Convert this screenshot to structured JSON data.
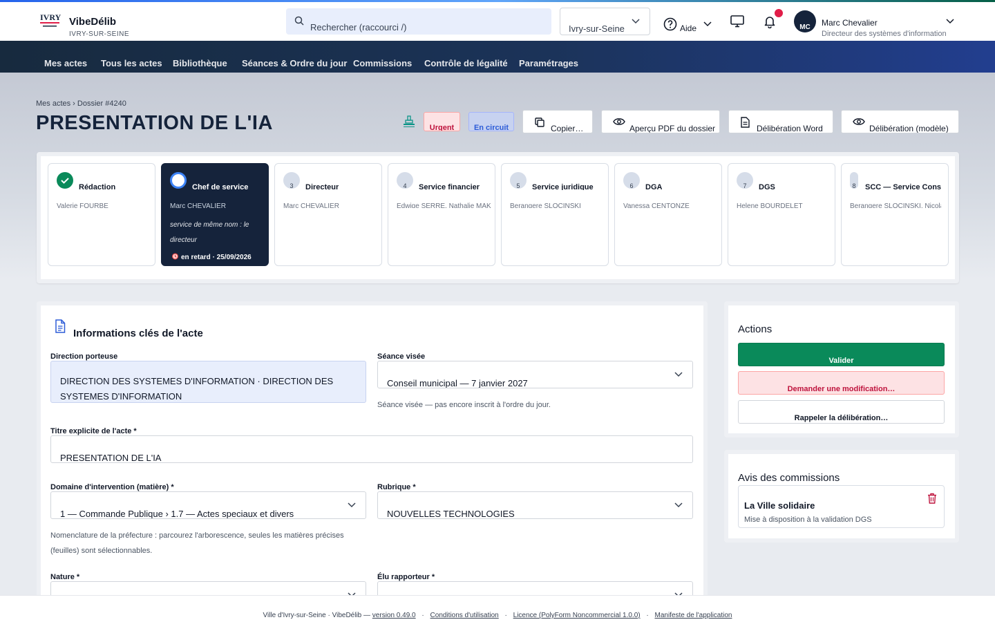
{
  "app": {
    "name": "VibeDélib",
    "city_caption": "IVRY-SUR-SEINE",
    "logo_text": "IVRY"
  },
  "header": {
    "search_placeholder": "Rechercher (raccourci /)",
    "city": "Ivry-sur-Seine",
    "help_label": "Aide",
    "user": {
      "initials": "MC",
      "name": "Marc Chevalier",
      "role": "Directeur des systèmes d'information"
    }
  },
  "nav": [
    "Mes actes",
    "Tous les actes",
    "Bibliothèque",
    "Séances & Ordre du jour",
    "Commissions",
    "Contrôle de légalité",
    "Paramétrages"
  ],
  "page": {
    "breadcrumb": "Mes actes › Dossier #4240",
    "title": "PRESENTATION DE L'IA",
    "badges": {
      "urgent": "Urgent",
      "circuit": "En circuit"
    },
    "buttons": {
      "copy": "Copier…",
      "pdf": "Aperçu PDF du dossier",
      "word": "Délibération Word",
      "model": "Délibération (modèle)"
    }
  },
  "steps": [
    {
      "num": "",
      "title": "Rédaction",
      "person": "Valerie FOURBE",
      "state": "done"
    },
    {
      "num": "",
      "title": "Chef de service",
      "person": "Marc CHEVALIER",
      "note": "service de même nom : le directeur",
      "late": "en retard · 25/09/2026",
      "state": "current"
    },
    {
      "num": "3",
      "title": "Directeur",
      "person": "Marc CHEVALIER",
      "state": "todo"
    },
    {
      "num": "4",
      "title": "Service financier",
      "person": "Edwige SERRE, Nathalie MAK",
      "state": "todo"
    },
    {
      "num": "5",
      "title": "Service juridique",
      "person": "Berangere SLOCINSKI",
      "state": "todo"
    },
    {
      "num": "6",
      "title": "DGA",
      "person": "Vanessa CENTONZE",
      "state": "todo"
    },
    {
      "num": "7",
      "title": "DGS",
      "person": "Helene BOURDELET",
      "state": "todo"
    },
    {
      "num": "8",
      "title": "SCC — Service Conseil",
      "person": "Berangere SLOCINSKI, Nicolas",
      "state": "todo"
    }
  ],
  "info": {
    "title": "Informations clés de l'acte",
    "direction": {
      "label": "Direction porteuse",
      "value": "DIRECTION DES SYSTEMES D'INFORMATION · DIRECTION DES SYSTEMES D'INFORMATION"
    },
    "seance": {
      "label": "Séance visée",
      "value": "Conseil municipal — 7 janvier 2027",
      "help": "Séance visée — pas encore inscrit à l'ordre du jour."
    },
    "titre": {
      "label": "Titre explicite de l'acte *",
      "value": "PRESENTATION DE L'IA"
    },
    "domaine": {
      "label": "Domaine d'intervention (matière) *",
      "value": "1 — Commande Publique › 1.7 — Actes speciaux et divers",
      "help": "Nomenclature de la préfecture : parcourez l'arborescence, seules les matières précises (feuilles) sont sélectionnables."
    },
    "rubrique": {
      "label": "Rubrique *",
      "value": "NOUVELLES TECHNOLOGIES"
    },
    "nature": {
      "label": "Nature *",
      "value": ""
    },
    "elu": {
      "label": "Élu rapporteur *",
      "value": ""
    }
  },
  "actions": {
    "title": "Actions",
    "valider": "Valider",
    "modification": "Demander une modification…",
    "rappeler": "Rappeler la délibération…"
  },
  "avis": {
    "title": "Avis des commissions",
    "items": [
      {
        "name": "La Ville solidaire",
        "status": "Mise à disposition à la validation DGS"
      }
    ]
  },
  "footer": {
    "prefix": "Ville d'Ivry-sur-Seine · VibeDélib —",
    "version": "version 0.49.0",
    "cgu": "Conditions d'utilisation",
    "licence": "Licence (PolyForm Noncommercial 1.0.0)",
    "manifest": "Manifeste de l'application"
  },
  "colors": {
    "navy": "#15233b",
    "accent": "#2b5bd7",
    "success": "#0a8a5a",
    "danger": "#be123c"
  }
}
